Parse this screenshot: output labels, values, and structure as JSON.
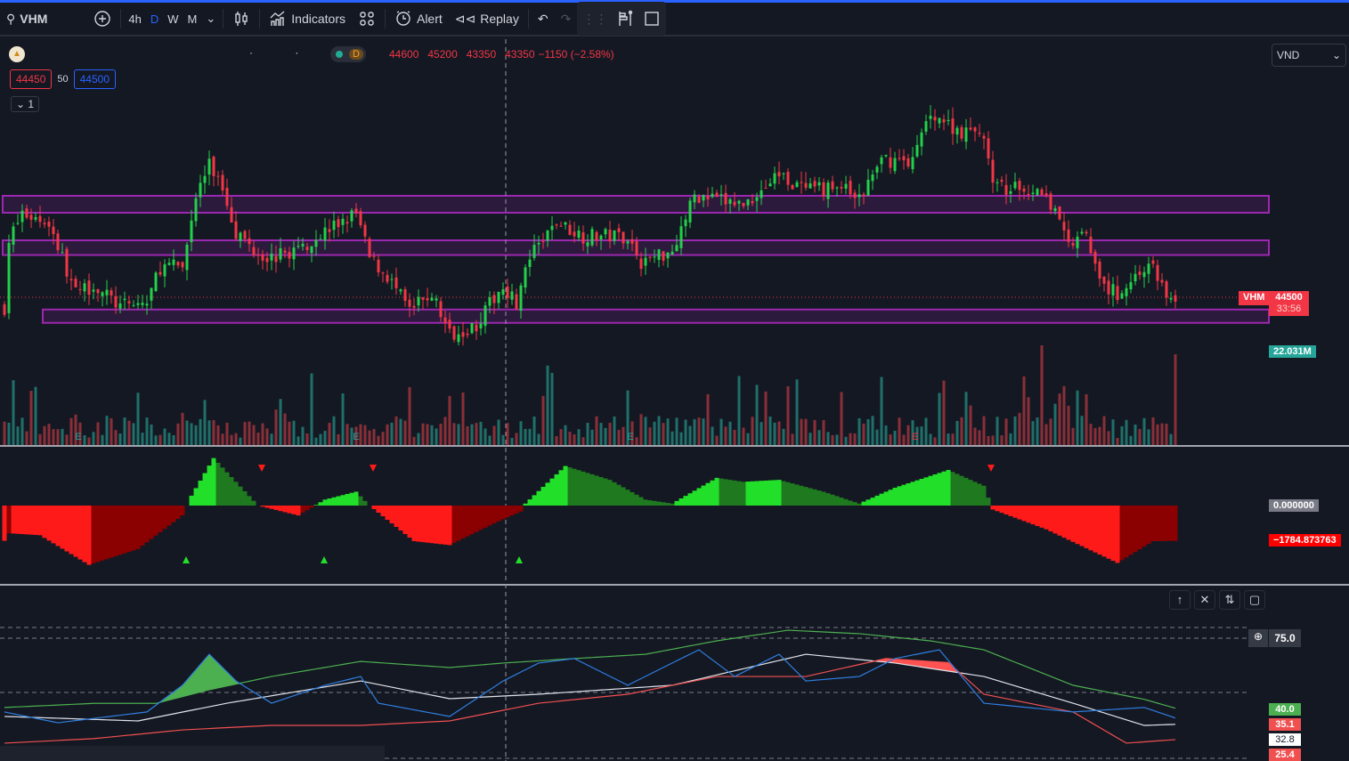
{
  "toolbar": {
    "symbol": "VHM",
    "timeframes": [
      "4h",
      "D",
      "W",
      "M"
    ],
    "active_timeframe": "D",
    "indicators_label": "Indicators",
    "alert_label": "Alert",
    "replay_label": "Replay"
  },
  "legend": {
    "interval_badge": "D",
    "open": "44600",
    "high": "45200",
    "low": "43350",
    "close": "43350",
    "change": "−1150 (−2.58%)",
    "bid": "44450",
    "spread": "50",
    "ask": "44500",
    "collapse_label": "1",
    "dots": "· ·"
  },
  "currency": {
    "selected": "VND"
  },
  "price_scale": {
    "symbol_tag": "VHM",
    "last_price": "44500",
    "countdown": "33:56",
    "volume_label": "22.031M"
  },
  "oscillator_scale": {
    "zero_label": "0.000000",
    "value_label": "−1784.873763"
  },
  "rsi_scale": {
    "level_label": "75.0",
    "values": [
      "40.0",
      "35.1",
      "32.8",
      "25.4"
    ]
  },
  "colors": {
    "up": "#22d14a",
    "down": "#f23645",
    "zone": "#9c27b0",
    "green_line": "#4caf50",
    "red_line": "#f05050",
    "blue_line": "#2f7fe0"
  },
  "chart_data": {
    "type": "candlestick",
    "price_keypoints": [
      [
        1,
        47060
      ],
      [
        4,
        48260
      ],
      [
        10,
        47860
      ],
      [
        16,
        44660
      ],
      [
        20,
        45060
      ],
      [
        26,
        44060
      ],
      [
        32,
        44260
      ],
      [
        35,
        45860
      ],
      [
        40,
        45860
      ],
      [
        43,
        49060
      ],
      [
        46,
        50460
      ],
      [
        49,
        49460
      ],
      [
        52,
        47460
      ],
      [
        56,
        46660
      ],
      [
        60,
        46260
      ],
      [
        66,
        46660
      ],
      [
        72,
        47460
      ],
      [
        79,
        48260
      ],
      [
        82,
        46260
      ],
      [
        86,
        45460
      ],
      [
        91,
        43860
      ],
      [
        96,
        44660
      ],
      [
        100,
        42860
      ],
      [
        106,
        43260
      ],
      [
        112,
        45060
      ],
      [
        115,
        44260
      ],
      [
        118,
        46260
      ],
      [
        124,
        47860
      ],
      [
        130,
        47260
      ],
      [
        140,
        47260
      ],
      [
        143,
        46060
      ],
      [
        150,
        46660
      ],
      [
        155,
        49060
      ],
      [
        160,
        48860
      ],
      [
        166,
        48660
      ],
      [
        174,
        50060
      ],
      [
        180,
        49260
      ],
      [
        188,
        49460
      ],
      [
        192,
        48860
      ],
      [
        197,
        50660
      ],
      [
        204,
        50660
      ],
      [
        208,
        52860
      ],
      [
        212,
        52260
      ],
      [
        216,
        51860
      ],
      [
        220,
        51860
      ],
      [
        222,
        49460
      ],
      [
        232,
        49260
      ],
      [
        236,
        48260
      ],
      [
        239,
        46860
      ],
      [
        243,
        47260
      ],
      [
        246,
        45060
      ],
      [
        250,
        44660
      ],
      [
        255,
        45660
      ],
      [
        258,
        45860
      ],
      [
        262,
        44260
      ],
      [
        264,
        44060
      ]
    ],
    "zones": [
      [
        49060,
        48300
      ],
      [
        47060,
        46400
      ],
      [
        43950,
        43350
      ]
    ],
    "oscillator_keypoints": [
      [
        1,
        -1400
      ],
      [
        8,
        -1500
      ],
      [
        19,
        -3000
      ],
      [
        30,
        -2200
      ],
      [
        40,
        -500
      ],
      [
        42,
        500
      ],
      [
        47,
        2400
      ],
      [
        52,
        1200
      ],
      [
        57,
        0
      ],
      [
        66,
        -500
      ],
      [
        72,
        300
      ],
      [
        79,
        700
      ],
      [
        82,
        0
      ],
      [
        92,
        -1800
      ],
      [
        100,
        -2000
      ],
      [
        110,
        -900
      ],
      [
        116,
        -300
      ],
      [
        117,
        100
      ],
      [
        126,
        2000
      ],
      [
        136,
        1300
      ],
      [
        144,
        300
      ],
      [
        150,
        100
      ],
      [
        160,
        1400
      ],
      [
        166,
        1200
      ],
      [
        174,
        1300
      ],
      [
        184,
        700
      ],
      [
        192,
        100
      ],
      [
        200,
        900
      ],
      [
        212,
        1800
      ],
      [
        220,
        1000
      ],
      [
        222,
        -200
      ],
      [
        234,
        -1200
      ],
      [
        250,
        -2900
      ],
      [
        258,
        -1800
      ],
      [
        264,
        -1784
      ]
    ],
    "rsi_lines": {
      "green": [
        [
          0,
          41
        ],
        [
          20,
          43
        ],
        [
          34,
          43
        ],
        [
          46,
          49.7
        ],
        [
          60,
          56.2
        ],
        [
          80,
          63.6
        ],
        [
          100,
          60.6
        ],
        [
          112,
          62.8
        ],
        [
          128,
          65
        ],
        [
          144,
          67.1
        ],
        [
          160,
          73.7
        ],
        [
          176,
          78.9
        ],
        [
          192,
          77.2
        ],
        [
          208,
          73.7
        ],
        [
          220,
          69.3
        ],
        [
          240,
          51.9
        ],
        [
          256,
          45
        ],
        [
          264,
          40
        ]
      ],
      "white": [
        [
          0,
          36.6
        ],
        [
          30,
          34.4
        ],
        [
          50,
          43.1
        ],
        [
          80,
          54
        ],
        [
          100,
          45.3
        ],
        [
          120,
          47.5
        ],
        [
          150,
          51.9
        ],
        [
          180,
          67.1
        ],
        [
          200,
          62.8
        ],
        [
          220,
          56.2
        ],
        [
          240,
          43.1
        ],
        [
          256,
          32.2
        ],
        [
          264,
          32.8
        ]
      ],
      "red": [
        [
          0,
          23.5
        ],
        [
          20,
          25.7
        ],
        [
          40,
          30
        ],
        [
          60,
          32.2
        ],
        [
          80,
          32.2
        ],
        [
          100,
          34.4
        ],
        [
          120,
          43.1
        ],
        [
          140,
          47.5
        ],
        [
          160,
          56.2
        ],
        [
          180,
          56.2
        ],
        [
          198,
          65
        ],
        [
          212,
          63
        ],
        [
          220,
          47.5
        ],
        [
          240,
          38.8
        ],
        [
          252,
          23.5
        ],
        [
          264,
          25.4
        ]
      ],
      "blue": [
        [
          0,
          38.8
        ],
        [
          12,
          33.5
        ],
        [
          32,
          38.8
        ],
        [
          40,
          51.9
        ],
        [
          46,
          67.1
        ],
        [
          52,
          54
        ],
        [
          60,
          43.1
        ],
        [
          72,
          51.9
        ],
        [
          80,
          56.2
        ],
        [
          84,
          43.1
        ],
        [
          100,
          36.6
        ],
        [
          112,
          54
        ],
        [
          120,
          62.8
        ],
        [
          128,
          65
        ],
        [
          140,
          51.9
        ],
        [
          152,
          65
        ],
        [
          156,
          69.3
        ],
        [
          164,
          56.2
        ],
        [
          174,
          67.1
        ],
        [
          180,
          54
        ],
        [
          192,
          56.2
        ],
        [
          200,
          65
        ],
        [
          210,
          69.3
        ],
        [
          220,
          43.1
        ],
        [
          240,
          38.8
        ],
        [
          256,
          41
        ],
        [
          264,
          35.1
        ]
      ]
    },
    "last_volume": "22.031M"
  }
}
